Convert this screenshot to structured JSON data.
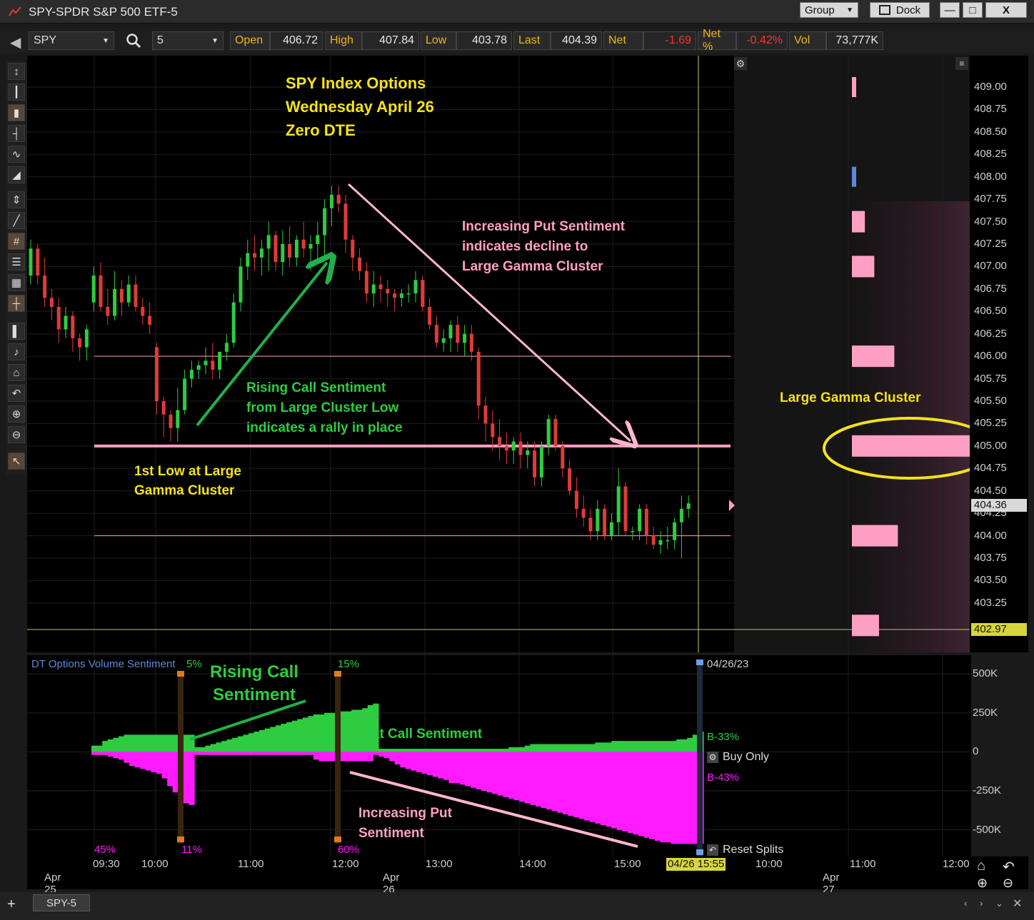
{
  "window": {
    "title": "SPY-SPDR S&P 500 ETF-5",
    "group_label": "Group",
    "dock_label": "Dock",
    "minimize_label": "—",
    "maximize_label": "□",
    "close_label": "X"
  },
  "quote": {
    "symbol": "SPY",
    "interval": "5",
    "open_label": "Open",
    "open": "406.72",
    "high_label": "High",
    "high": "407.84",
    "low_label": "Low",
    "low": "403.78",
    "last_label": "Last",
    "last": "404.39",
    "net_label": "Net",
    "net": "-1.69",
    "netpct_label": "Net %",
    "netpct": "-0.42%",
    "vol_label": "Vol",
    "vol": "73,777K"
  },
  "annotations": {
    "title1": "SPY Index Options",
    "title2": "Wednesday April 26",
    "title3": "Zero DTE",
    "put1": "Increasing Put Sentiment",
    "put2": "indicates decline to",
    "put3": "Large Gamma Cluster",
    "call1": "Rising Call Sentiment",
    "call2": "from Large Cluster Low",
    "call3": "indicates a rally in place",
    "low1": "1st Low at Large",
    "low2": "Gamma Cluster",
    "gamma": "Large Gamma Cluster",
    "rc1": "Rising Call",
    "rc2": "Sentiment",
    "flat": "Flat Call Sentiment",
    "ip1": "Increasing Put",
    "ip2": "Sentiment"
  },
  "price_axis": {
    "ticks": [
      "409.00",
      "408.75",
      "408.50",
      "408.25",
      "408.00",
      "407.75",
      "407.50",
      "407.25",
      "407.00",
      "406.75",
      "406.50",
      "406.25",
      "406.00",
      "405.75",
      "405.50",
      "405.25",
      "405.00",
      "404.75",
      "404.50",
      "404.25",
      "404.00",
      "403.75",
      "403.50",
      "403.25"
    ],
    "last_tag": "404.36",
    "cursor_tag": "402.97",
    "last_tag_color": "#d9d9d9",
    "cursor_tag_color": "#d6d63a"
  },
  "chart_data": {
    "type": "candlestick",
    "candle_colors": {
      "up": "#2ecc40",
      "down": "#e03a3a"
    },
    "y_range": [
      402.7,
      409.35
    ],
    "horizontal_levels": [
      406.0,
      405.0,
      404.0
    ],
    "gamma_profile": {
      "strikes": [
        409.0,
        408.0,
        407.5,
        407.0,
        406.0,
        405.0,
        404.0,
        403.0
      ],
      "relative_size": [
        0.05,
        0.06,
        0.11,
        0.19,
        0.36,
        1.0,
        0.39,
        0.23
      ],
      "colors": [
        "#ff9fc4",
        "#5b8be0",
        "#ff9fc4",
        "#ff9fc4",
        "#ff9fc4",
        "#ff9fc4",
        "#ff9fc4",
        "#ff9fc4"
      ]
    },
    "candles": [
      [
        406.9,
        407.3,
        406.8,
        407.2
      ],
      [
        407.2,
        407.25,
        406.8,
        406.9
      ],
      [
        406.9,
        407.1,
        406.55,
        406.65
      ],
      [
        406.65,
        406.75,
        406.4,
        406.55
      ],
      [
        406.55,
        406.65,
        406.15,
        406.3
      ],
      [
        406.3,
        406.55,
        406.2,
        406.45
      ],
      [
        406.45,
        406.5,
        406.05,
        406.2
      ],
      [
        406.2,
        406.25,
        405.95,
        406.1
      ],
      [
        406.1,
        406.35,
        405.95,
        406.3
      ],
      [
        406.6,
        407.0,
        406.5,
        406.9
      ],
      [
        406.9,
        407.05,
        406.5,
        406.55
      ],
      [
        406.55,
        406.75,
        406.35,
        406.45
      ],
      [
        406.45,
        406.95,
        406.4,
        406.75
      ],
      [
        406.75,
        406.85,
        406.45,
        406.6
      ],
      [
        406.6,
        406.9,
        406.55,
        406.8
      ],
      [
        406.8,
        406.9,
        406.5,
        406.55
      ],
      [
        406.55,
        406.65,
        406.35,
        406.45
      ],
      [
        406.45,
        406.6,
        406.25,
        406.35
      ],
      [
        406.1,
        406.15,
        405.35,
        405.5
      ],
      [
        405.5,
        405.55,
        405.1,
        405.35
      ],
      [
        405.35,
        405.4,
        405.05,
        405.2
      ],
      [
        405.2,
        405.65,
        405.05,
        405.4
      ],
      [
        405.4,
        405.85,
        405.35,
        405.75
      ],
      [
        405.75,
        405.95,
        405.65,
        405.85
      ],
      [
        405.85,
        405.95,
        405.75,
        405.9
      ],
      [
        405.9,
        406.1,
        405.8,
        405.95
      ],
      [
        405.95,
        406.15,
        405.75,
        405.85
      ],
      [
        405.85,
        406.05,
        405.75,
        406.05
      ],
      [
        406.05,
        406.25,
        405.95,
        406.15
      ],
      [
        406.15,
        406.7,
        406.1,
        406.6
      ],
      [
        406.6,
        407.1,
        406.5,
        407.0
      ],
      [
        407.0,
        407.3,
        406.85,
        407.15
      ],
      [
        407.15,
        407.35,
        406.95,
        407.1
      ],
      [
        407.1,
        407.3,
        406.9,
        407.2
      ],
      [
        407.2,
        407.5,
        406.95,
        407.35
      ],
      [
        407.35,
        407.4,
        406.95,
        407.05
      ],
      [
        407.05,
        407.4,
        406.9,
        407.25
      ],
      [
        407.25,
        407.45,
        407.0,
        407.1
      ],
      [
        407.1,
        407.35,
        407.0,
        407.3
      ],
      [
        407.3,
        407.5,
        407.1,
        407.2
      ],
      [
        407.2,
        407.35,
        406.95,
        407.25
      ],
      [
        407.25,
        407.5,
        407.05,
        407.35
      ],
      [
        407.35,
        407.75,
        407.1,
        407.65
      ],
      [
        407.65,
        407.9,
        407.45,
        407.8
      ],
      [
        407.8,
        407.9,
        407.6,
        407.7
      ],
      [
        407.7,
        407.8,
        407.15,
        407.3
      ],
      [
        407.3,
        407.35,
        406.95,
        407.1
      ],
      [
        407.1,
        407.2,
        406.85,
        406.95
      ],
      [
        406.95,
        407.05,
        406.6,
        406.7
      ],
      [
        406.7,
        406.95,
        406.55,
        406.8
      ],
      [
        406.8,
        406.9,
        406.6,
        406.75
      ],
      [
        406.75,
        406.85,
        406.55,
        406.7
      ],
      [
        406.7,
        406.75,
        406.5,
        406.65
      ],
      [
        406.65,
        406.75,
        406.55,
        406.7
      ],
      [
        406.7,
        406.8,
        406.6,
        406.7
      ],
      [
        406.7,
        406.95,
        406.6,
        406.85
      ],
      [
        406.85,
        406.9,
        406.5,
        406.55
      ],
      [
        406.55,
        406.65,
        406.3,
        406.35
      ],
      [
        406.35,
        406.45,
        406.1,
        406.15
      ],
      [
        406.15,
        406.3,
        406.05,
        406.2
      ],
      [
        406.2,
        406.4,
        406.05,
        406.35
      ],
      [
        406.35,
        406.45,
        406.05,
        406.15
      ],
      [
        406.15,
        406.35,
        406.0,
        406.25
      ],
      [
        406.25,
        406.35,
        405.95,
        406.05
      ],
      [
        406.05,
        406.1,
        405.3,
        405.45
      ],
      [
        405.45,
        405.55,
        405.05,
        405.25
      ],
      [
        405.25,
        405.4,
        404.95,
        405.1
      ],
      [
        405.1,
        405.3,
        404.85,
        405.0
      ],
      [
        405.0,
        405.15,
        404.8,
        404.95
      ],
      [
        404.95,
        405.1,
        404.8,
        405.05
      ],
      [
        405.05,
        405.15,
        404.75,
        404.9
      ],
      [
        404.9,
        405.05,
        404.75,
        404.95
      ],
      [
        404.95,
        405.05,
        404.55,
        404.65
      ],
      [
        404.65,
        405.05,
        404.55,
        405.0
      ],
      [
        405.0,
        405.35,
        404.9,
        405.3
      ],
      [
        405.3,
        405.35,
        404.95,
        405.0
      ],
      [
        405.0,
        405.05,
        404.65,
        404.75
      ],
      [
        404.75,
        404.85,
        404.45,
        404.5
      ],
      [
        404.5,
        404.65,
        404.2,
        404.3
      ],
      [
        404.3,
        404.45,
        404.1,
        404.2
      ],
      [
        404.2,
        404.3,
        403.95,
        404.05
      ],
      [
        404.05,
        404.4,
        403.95,
        404.3
      ],
      [
        404.3,
        404.35,
        403.95,
        404.0
      ],
      [
        404.0,
        404.25,
        403.95,
        404.15
      ],
      [
        404.15,
        404.75,
        404.0,
        404.55
      ],
      [
        404.55,
        404.6,
        404.0,
        404.05
      ],
      [
        404.05,
        404.1,
        403.95,
        404.05
      ],
      [
        404.05,
        404.35,
        403.95,
        404.3
      ],
      [
        404.3,
        404.35,
        403.9,
        404.0
      ],
      [
        404.0,
        404.1,
        403.85,
        403.9
      ],
      [
        403.9,
        404.05,
        403.8,
        403.95
      ],
      [
        403.95,
        404.1,
        403.85,
        403.95
      ],
      [
        403.95,
        404.2,
        403.85,
        404.15
      ],
      [
        404.15,
        404.45,
        403.75,
        404.3
      ],
      [
        404.3,
        404.45,
        404.2,
        404.36
      ]
    ],
    "sentiment": {
      "label": "DT Options Volume Sentiment",
      "y_range": [
        -680000,
        620000
      ],
      "y_ticks": [
        "500K",
        "250K",
        "0",
        "-250K",
        "-500K"
      ],
      "call_color": "#2ecc40",
      "put_color": "#ff1aff",
      "calls": [
        40000,
        40000,
        70000,
        80000,
        90000,
        100000,
        110000,
        110000,
        110000,
        110000,
        110000,
        110000,
        110000,
        110000,
        110000,
        110000,
        110000,
        110000,
        110000,
        30000,
        30000,
        40000,
        50000,
        60000,
        70000,
        80000,
        90000,
        100000,
        110000,
        120000,
        130000,
        140000,
        150000,
        160000,
        170000,
        180000,
        190000,
        200000,
        210000,
        220000,
        230000,
        240000,
        240000,
        250000,
        250000,
        250000,
        260000,
        260000,
        270000,
        270000,
        280000,
        300000,
        310000,
        20000,
        20000,
        20000,
        20000,
        20000,
        20000,
        20000,
        20000,
        20000,
        20000,
        20000,
        20000,
        20000,
        20000,
        20000,
        20000,
        20000,
        20000,
        20000,
        20000,
        20000,
        20000,
        20000,
        20000,
        30000,
        30000,
        30000,
        40000,
        50000,
        50000,
        50000,
        50000,
        50000,
        50000,
        50000,
        50000,
        50000,
        50000,
        50000,
        50000,
        60000,
        60000,
        60000,
        70000,
        70000,
        70000,
        70000,
        70000,
        70000,
        70000,
        70000,
        70000,
        70000,
        70000,
        70000,
        80000,
        80000,
        90000,
        110000,
        130000
      ],
      "puts": [
        -20000,
        -20000,
        -20000,
        -30000,
        -40000,
        -50000,
        -70000,
        -90000,
        -100000,
        -110000,
        -120000,
        -130000,
        -140000,
        -170000,
        -220000,
        -260000,
        -300000,
        -330000,
        -340000,
        -20000,
        -20000,
        -20000,
        -20000,
        -20000,
        -20000,
        -20000,
        -20000,
        -20000,
        -20000,
        -20000,
        -20000,
        -20000,
        -20000,
        -20000,
        -20000,
        -20000,
        -20000,
        -20000,
        -20000,
        -20000,
        -20000,
        -50000,
        -60000,
        -60000,
        -60000,
        -60000,
        -60000,
        -60000,
        -60000,
        -60000,
        -60000,
        -60000,
        -20000,
        -30000,
        -40000,
        -60000,
        -80000,
        -100000,
        -110000,
        -120000,
        -130000,
        -140000,
        -150000,
        -160000,
        -170000,
        -180000,
        -200000,
        -200000,
        -210000,
        -220000,
        -230000,
        -240000,
        -250000,
        -260000,
        -270000,
        -280000,
        -290000,
        -300000,
        -310000,
        -320000,
        -330000,
        -340000,
        -350000,
        -360000,
        -370000,
        -380000,
        -390000,
        -400000,
        -410000,
        -420000,
        -430000,
        -440000,
        -450000,
        -460000,
        -470000,
        -480000,
        -490000,
        -500000,
        -510000,
        -520000,
        -530000,
        -540000,
        -550000,
        -560000,
        -570000,
        -580000,
        -580000,
        -590000,
        -590000,
        -590000,
        -590000,
        -590000,
        -590000,
        -590000,
        -590000,
        -590000,
        -600000
      ]
    }
  },
  "lower_pane": {
    "label": "DT Options Volume Sentiment",
    "pct_top_1": "5%",
    "pct_top_2": "15%",
    "pct_bot_1": "45%",
    "pct_bot_2": "11%",
    "pct_bot_3": "60%",
    "date_tag": "04/26/23",
    "buy_pct": "B-33%",
    "buy_only": "Buy Only",
    "sell_pct": "B-43%",
    "reset_splits": "Reset Splits"
  },
  "time_axis": {
    "labels": [
      "09:30",
      "10:00",
      "11:00",
      "12:00",
      "13:00",
      "14:00",
      "15:00",
      "10:00",
      "11:00",
      "12:00"
    ],
    "days": [
      "Apr 25",
      "Apr 26",
      "Apr 27"
    ],
    "cursor_tag": "04/26 15:55"
  },
  "bottom": {
    "add_label": "+",
    "tab_label": "SPY-5"
  }
}
